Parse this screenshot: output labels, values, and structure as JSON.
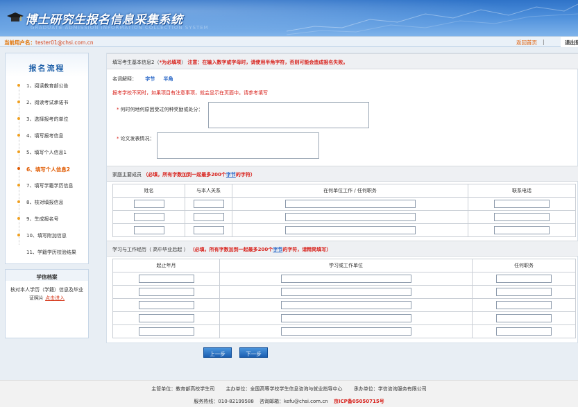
{
  "header": {
    "title": "博士研究生报名信息采集系统",
    "subtitle": "GRADUATE ADMISSION INFORMATION COLLECTION SYSTEM"
  },
  "userbar": {
    "user_label": "当前用户名：",
    "user_value": "tester01@chsi.com.cn",
    "home_link": "返回首页",
    "separator": "|",
    "logout": "退出登录"
  },
  "sidebar": {
    "title": "报名流程",
    "items": [
      {
        "label": "1、阅读教育部公告"
      },
      {
        "label": "2、阅读考试承诺书"
      },
      {
        "label": "3、选择报考的单位"
      },
      {
        "label": "4、填写报考信息"
      },
      {
        "label": "5、填写个人信息1"
      },
      {
        "label": "6、填写个人信息2"
      },
      {
        "label": "7、填写学籍学历信息"
      },
      {
        "label": "8、核对填报信息"
      },
      {
        "label": "9、生成报名号"
      },
      {
        "label": "10、填写附加信息"
      },
      {
        "label": "11、学籍学历校验结果"
      }
    ],
    "active_index": 5
  },
  "archive": {
    "title": "学信档案",
    "text": "核对本人学历（学籍）信息及毕业证照片",
    "link": "点击进入"
  },
  "form": {
    "section1_title": "填写考生基本信息2（",
    "section1_star": "*为必填项",
    "section1_close": "）",
    "section1_warning": "注意：在输入数字或字母时，请使用半角字符，否则可能会造成报名失败。",
    "glossary_label": "名词解释：",
    "glossary_link1": "字节",
    "glossary_link2": "半角",
    "note": "报考学校不同时，如果项目有注意事项，就会显示在页面中。请参考填写",
    "field1_label": "何时何地何原因受过何种奖励或处分：",
    "field2_label": "论文发表情况：",
    "star": "*"
  },
  "family": {
    "title": "家庭主要成员",
    "warning_pre": "（必填，所有字数加到一起最多200个",
    "link": "字节",
    "warning_post": "的字符）",
    "columns": [
      "姓名",
      "与本人关系",
      "在何单位工作 / 任何职务",
      "联系电话"
    ],
    "rows": 3
  },
  "experience": {
    "title": "学习与工作经历（ 高中毕业后起 ）",
    "warning_pre": "（必填，所有字数加到一起最多200个",
    "link": "字节",
    "warning_post": "的字符，请精简填写）",
    "columns": [
      "起止年月",
      "学习或工作单位",
      "任何职务"
    ],
    "rows": 5
  },
  "buttons": {
    "prev": "上一步",
    "next": "下一步"
  },
  "footer": {
    "sponsor": "主管单位：教育部高校学生司",
    "host": "主办单位：全国高等学校学生信息咨询与就业指导中心",
    "operator": "承办单位：学信咨询服务有限公司",
    "hotline": "服务热线：010-82199588",
    "email": "咨询邮箱：kefu@chsi.com.cn",
    "icp": "京ICP备05050715号"
  },
  "colors": {
    "header_blue": "#2f73c8",
    "warning_red": "#d8201a",
    "link_blue": "#1f60c4",
    "active_orange": "#e05a00"
  }
}
